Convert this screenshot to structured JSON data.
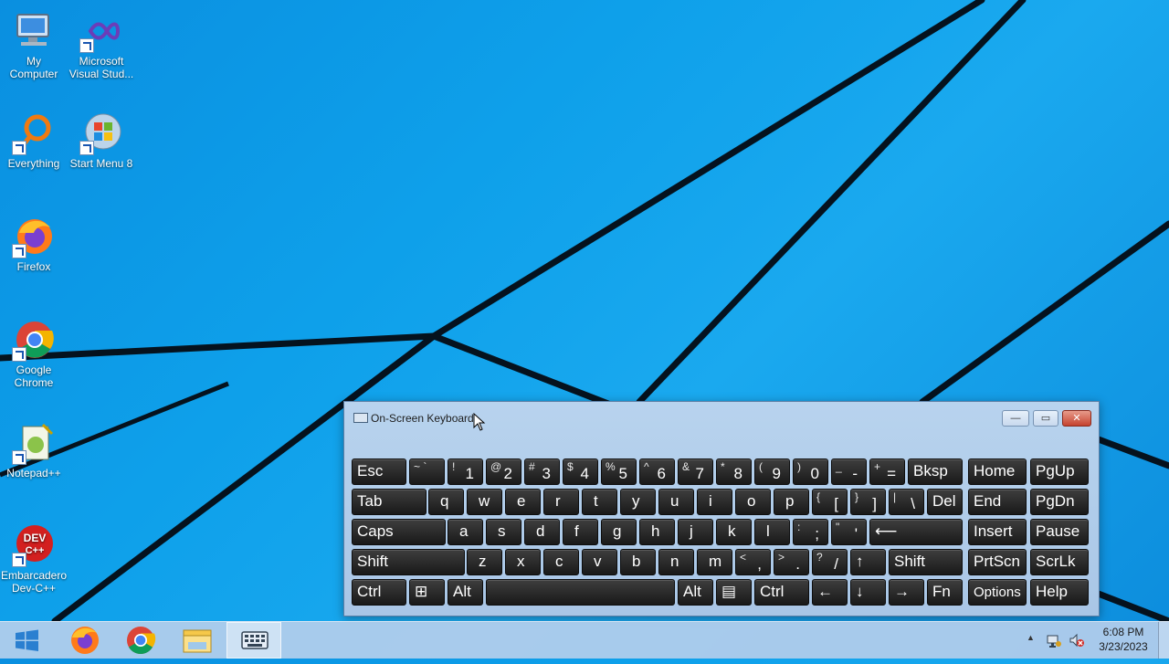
{
  "desktop": {
    "icons": [
      {
        "label_line1": "My",
        "label_line2": "Computer"
      },
      {
        "label_line1": "Microsoft",
        "label_line2": "Visual Stud..."
      },
      {
        "label_line1": "Everything",
        "label_line2": ""
      },
      {
        "label_line1": "Start Menu 8",
        "label_line2": ""
      },
      {
        "label_line1": "Firefox",
        "label_line2": ""
      },
      {
        "label_line1": "Google",
        "label_line2": "Chrome"
      },
      {
        "label_line1": "Notepad++",
        "label_line2": ""
      },
      {
        "label_line1": "Embarcadero",
        "label_line2": "Dev-C++"
      }
    ],
    "dev_icon_text": "DEV\nC++"
  },
  "osk": {
    "title": "On-Screen Keyboard",
    "minimize": "—",
    "maximize": "▭",
    "close": "✕",
    "row1": [
      {
        "main": "Esc",
        "sub": ""
      },
      {
        "main": "",
        "sub": "~ `"
      },
      {
        "main": "1",
        "sub": "!"
      },
      {
        "main": "2",
        "sub": "@"
      },
      {
        "main": "3",
        "sub": "#"
      },
      {
        "main": "4",
        "sub": "$"
      },
      {
        "main": "5",
        "sub": "%"
      },
      {
        "main": "6",
        "sub": "^"
      },
      {
        "main": "7",
        "sub": "&"
      },
      {
        "main": "8",
        "sub": "*"
      },
      {
        "main": "9",
        "sub": "("
      },
      {
        "main": "0",
        "sub": ")"
      },
      {
        "main": "-",
        "sub": "_"
      },
      {
        "main": "=",
        "sub": "+"
      },
      {
        "main": "Bksp",
        "sub": ""
      },
      {
        "main": "Home",
        "sub": ""
      },
      {
        "main": "PgUp",
        "sub": ""
      }
    ],
    "row2": [
      {
        "main": "Tab",
        "sub": ""
      },
      {
        "main": "q",
        "sub": ""
      },
      {
        "main": "w",
        "sub": ""
      },
      {
        "main": "e",
        "sub": ""
      },
      {
        "main": "r",
        "sub": ""
      },
      {
        "main": "t",
        "sub": ""
      },
      {
        "main": "y",
        "sub": ""
      },
      {
        "main": "u",
        "sub": ""
      },
      {
        "main": "i",
        "sub": ""
      },
      {
        "main": "o",
        "sub": ""
      },
      {
        "main": "p",
        "sub": ""
      },
      {
        "main": "[",
        "sub": "{"
      },
      {
        "main": "]",
        "sub": "}"
      },
      {
        "main": "\\",
        "sub": "|"
      },
      {
        "main": "Del",
        "sub": ""
      },
      {
        "main": "End",
        "sub": ""
      },
      {
        "main": "PgDn",
        "sub": ""
      }
    ],
    "row3": [
      {
        "main": "Caps",
        "sub": ""
      },
      {
        "main": "a",
        "sub": ""
      },
      {
        "main": "s",
        "sub": ""
      },
      {
        "main": "d",
        "sub": ""
      },
      {
        "main": "f",
        "sub": ""
      },
      {
        "main": "g",
        "sub": ""
      },
      {
        "main": "h",
        "sub": ""
      },
      {
        "main": "j",
        "sub": ""
      },
      {
        "main": "k",
        "sub": ""
      },
      {
        "main": "l",
        "sub": ""
      },
      {
        "main": ";",
        "sub": ":"
      },
      {
        "main": "'",
        "sub": "\""
      },
      {
        "main": "⟵",
        "sub": ""
      },
      {
        "main": "Insert",
        "sub": ""
      },
      {
        "main": "Pause",
        "sub": ""
      }
    ],
    "row4": [
      {
        "main": "Shift",
        "sub": ""
      },
      {
        "main": "z",
        "sub": ""
      },
      {
        "main": "x",
        "sub": ""
      },
      {
        "main": "c",
        "sub": ""
      },
      {
        "main": "v",
        "sub": ""
      },
      {
        "main": "b",
        "sub": ""
      },
      {
        "main": "n",
        "sub": ""
      },
      {
        "main": "m",
        "sub": ""
      },
      {
        "main": ",",
        "sub": "<"
      },
      {
        "main": ".",
        "sub": ">"
      },
      {
        "main": "/",
        "sub": "?"
      },
      {
        "main": "↑",
        "sub": ""
      },
      {
        "main": "Shift",
        "sub": ""
      },
      {
        "main": "PrtScn",
        "sub": ""
      },
      {
        "main": "ScrLk",
        "sub": ""
      }
    ],
    "row5": [
      {
        "main": "Ctrl",
        "sub": ""
      },
      {
        "main": "⊞",
        "sub": ""
      },
      {
        "main": "Alt",
        "sub": ""
      },
      {
        "main": "",
        "sub": ""
      },
      {
        "main": "Alt",
        "sub": ""
      },
      {
        "main": "▤",
        "sub": ""
      },
      {
        "main": "Ctrl",
        "sub": ""
      },
      {
        "main": "←",
        "sub": ""
      },
      {
        "main": "↓",
        "sub": ""
      },
      {
        "main": "→",
        "sub": ""
      },
      {
        "main": "Fn",
        "sub": ""
      },
      {
        "main": "Options",
        "sub": ""
      },
      {
        "main": "Help",
        "sub": ""
      }
    ]
  },
  "taskbar": {
    "time": "6:08 PM",
    "date": "3/23/2023",
    "tray_expand": "▲"
  },
  "colors": {
    "desktop": "#0ea0ea",
    "key_bg": "#2a2a2a",
    "osk_bg": "#b8d3ee"
  }
}
